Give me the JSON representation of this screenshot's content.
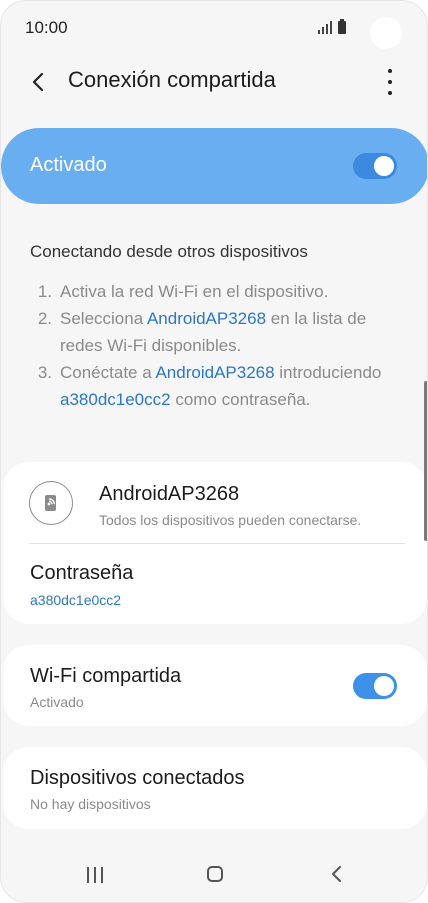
{
  "status_bar": {
    "time": "10:00"
  },
  "app_bar": {
    "title": "Conexión compartida",
    "back_icon": "back-arrow-icon",
    "more_icon": "more-options-icon"
  },
  "master_switch": {
    "label": "Activado",
    "state": true
  },
  "instructions": {
    "title": "Conectando desde otros dispositivos",
    "steps": [
      {
        "num": "1.",
        "text": "Activa la red Wi-Fi en el dispositivo."
      },
      {
        "num": "2.",
        "pre": "Selecciona ",
        "link": "AndroidAP3268",
        "post": " en la lista de redes Wi-Fi disponibles."
      },
      {
        "num": "3.",
        "pre": "Conéctate a ",
        "link": "AndroidAP3268",
        "mid": " introduciendo ",
        "link2": "a380dc1e0cc2",
        "post": " como contraseña."
      }
    ]
  },
  "network": {
    "icon": "hotspot-icon",
    "name": "AndroidAP3268",
    "subtitle": "Todos los dispositivos pueden conectarse.",
    "password_label": "Contraseña",
    "password_value": "a380dc1e0cc2"
  },
  "wifi_sharing": {
    "title": "Wi-Fi compartida",
    "status": "Activado",
    "state": true
  },
  "connected_devices": {
    "title": "Dispositivos conectados",
    "status": "No hay dispositivos"
  },
  "colors": {
    "accent": "#3e91e8",
    "master_bg": "#6aaef2",
    "link": "#2b76c9",
    "background": "#f6f6f6"
  }
}
